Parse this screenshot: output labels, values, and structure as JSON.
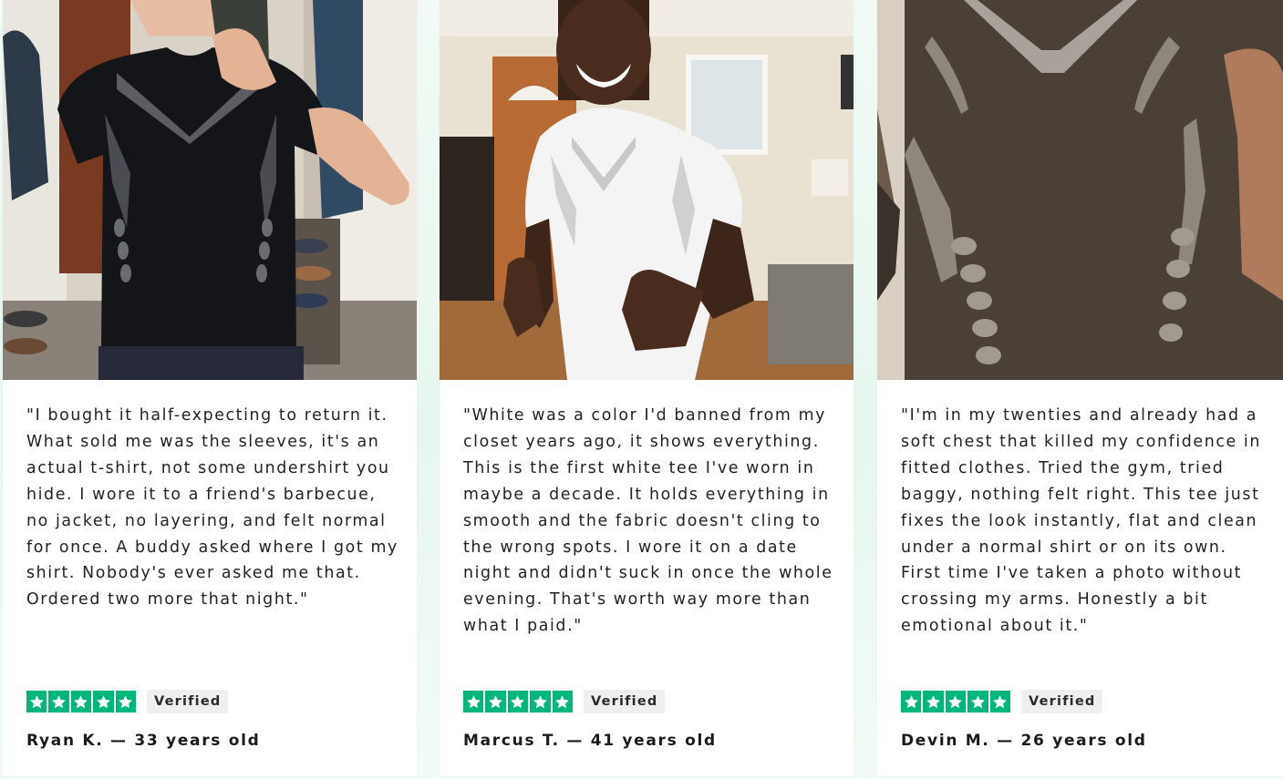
{
  "reviews": [
    {
      "quote": "\"I bought it half-expecting to return it. What sold me was the sleeves, it's an actual t-shirt, not some undershirt you hide. I wore it to a friend's barbecue, no jacket, no layering, and felt normal for once. A buddy asked where I got my shirt. Nobody's ever asked me that. Ordered two more that night.\"",
      "rating": 5,
      "badge": "Verified",
      "author": "Ryan K. — 33 years old",
      "shirt_color": "#141518"
    },
    {
      "quote": "\"White was a color I'd banned from my closet years ago, it shows everything. This is the first white tee I've worn in maybe a decade. It holds everything in smooth and the fabric doesn't cling to the wrong spots. I wore it on a date night and didn't suck in once the whole evening. That's worth way more than what I paid.\"",
      "rating": 5,
      "badge": "Verified",
      "author": "Marcus T. — 41 years old",
      "shirt_color": "#f4f4f4"
    },
    {
      "quote": "\"I'm in my twenties and already had a soft chest that killed my confidence in fitted clothes. Tried the gym, tried baggy, nothing felt right. This tee just fixes the look instantly, flat and clean under a normal shirt or on its own. First time I've taken a photo without crossing my arms. Honestly a bit emotional about it.\"",
      "rating": 5,
      "badge": "Verified",
      "author": "Devin M. — 26 years old",
      "shirt_color": "#4a4036"
    }
  ],
  "colors": {
    "star_green": "#00b67a",
    "badge_bg": "#eef0ee",
    "text": "#222222",
    "page_bg": "#e6f7ef"
  }
}
